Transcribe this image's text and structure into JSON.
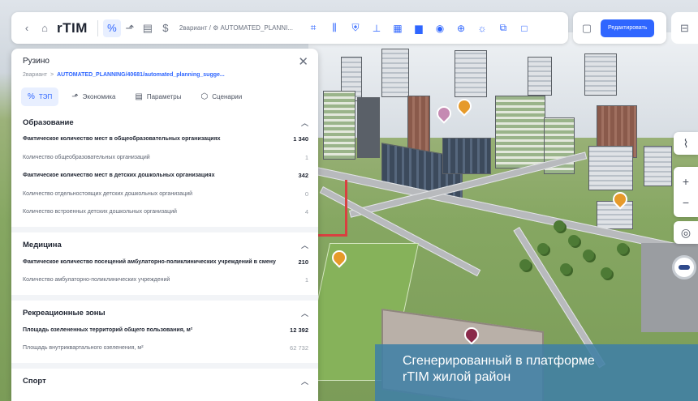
{
  "toolbar": {
    "logo": "rTIM",
    "breadcrumb": "2вариант / ⚙ AUTOMATED_PLANNI...",
    "edit_label": "Редактировать"
  },
  "panel": {
    "title": "Рузино",
    "breadcrumb_root": "2вариант",
    "breadcrumb_sep": ">",
    "breadcrumb_path": "AUTOMATED_PLANNING/40681/automated_planning_sugge...",
    "tabs": [
      {
        "label": "ТЭП",
        "icon": "percent-icon",
        "active": true
      },
      {
        "label": "Экономика",
        "icon": "chart-icon",
        "active": false
      },
      {
        "label": "Параметры",
        "icon": "document-icon",
        "active": false
      },
      {
        "label": "Сценарии",
        "icon": "cube-icon",
        "active": false
      }
    ],
    "sections": [
      {
        "title": "Образование",
        "rows": [
          {
            "label": "Фактическое количество мест в общеобразовательных организациях",
            "value": "1 340"
          },
          {
            "label": "Количество общеобразовательных организаций",
            "value": "1"
          },
          {
            "label": "Фактическое количество мест в детских дошкольных организациях",
            "value": "342"
          },
          {
            "label": "Количество отдельностоящих детских дошкольных организаций",
            "value": "0"
          },
          {
            "label": "Количество встроенных детских дошкольных организаций",
            "value": "4"
          }
        ]
      },
      {
        "title": "Медицина",
        "rows": [
          {
            "label": "Фактическое количество посещений амбулаторно-поликлинических учреждений в смену",
            "value": "210"
          },
          {
            "label": "Количество амбулаторно-поликлинических учреждений",
            "value": "1"
          }
        ]
      },
      {
        "title": "Рекреационные зоны",
        "rows": [
          {
            "label": "Площадь озелененных территорий общего пользования, м²",
            "value": "12 392"
          },
          {
            "label": "Площадь внутриквартального озеленения, м²",
            "value": "62 732"
          }
        ]
      },
      {
        "title": "Спорт",
        "rows": []
      }
    ]
  },
  "caption": {
    "line1": "Сгенерированный в платформе",
    "line2": "rTIM жилой район"
  },
  "colors": {
    "accent": "#2f66ff",
    "caption_bg": "#4080a5"
  }
}
